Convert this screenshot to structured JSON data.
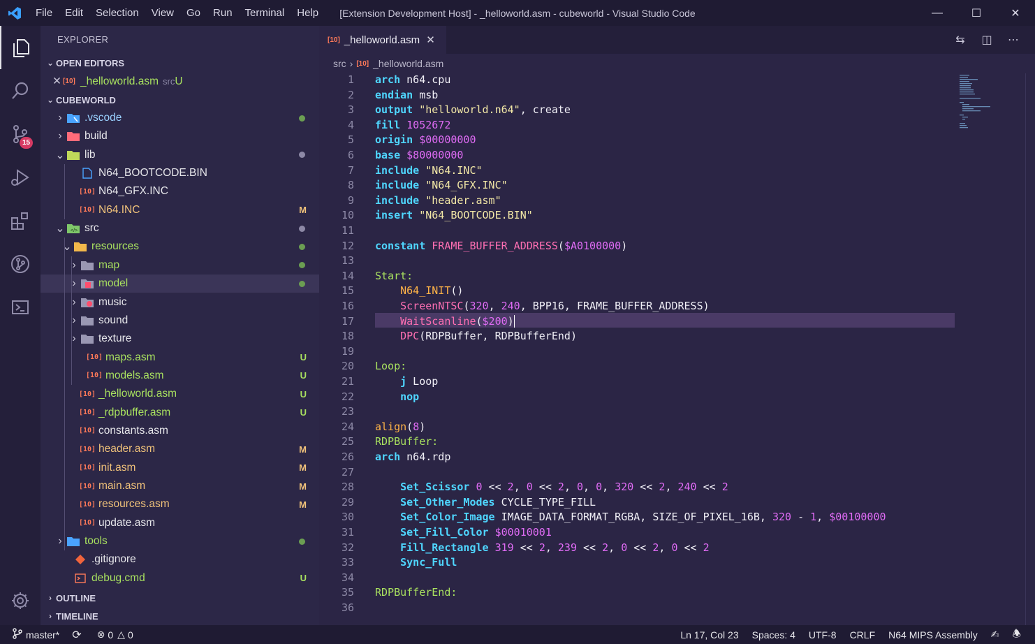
{
  "titlebar": {
    "menu": [
      "File",
      "Edit",
      "Selection",
      "View",
      "Go",
      "Run",
      "Terminal",
      "Help"
    ],
    "title": "[Extension Development Host] - _helloworld.asm - cubeworld - Visual Studio Code"
  },
  "activity": {
    "source_control_badge": "15"
  },
  "sidebar": {
    "title": "EXPLORER",
    "open_editors_label": "OPEN EDITORS",
    "open_editor": {
      "name": "_helloworld.asm",
      "dir": "src",
      "status": "U"
    },
    "workspace_label": "CUBEWORLD",
    "outline_label": "OUTLINE",
    "timeline_label": "TIMELINE",
    "tree": [
      {
        "name": ".vscode",
        "status": "",
        "color": "#9ad1ff"
      },
      {
        "name": "build",
        "status": "",
        "color": "#e6e6ea"
      },
      {
        "name": "lib",
        "status": "",
        "color": "#e6e6ea"
      },
      {
        "name": "N64_BOOTCODE.BIN",
        "status": "",
        "color": "#e6e6ea"
      },
      {
        "name": "N64_GFX.INC",
        "status": "",
        "color": "#e6e6ea"
      },
      {
        "name": "N64.INC",
        "status": "M",
        "color": "#f0c27a"
      },
      {
        "name": "src",
        "status": "",
        "color": "#e6e6ea"
      },
      {
        "name": "resources",
        "status": "",
        "color": "#a8e05f"
      },
      {
        "name": "map",
        "status": "",
        "color": "#a8e05f"
      },
      {
        "name": "model",
        "status": "",
        "color": "#a8e05f"
      },
      {
        "name": "music",
        "status": "",
        "color": "#e6e6ea"
      },
      {
        "name": "sound",
        "status": "",
        "color": "#e6e6ea"
      },
      {
        "name": "texture",
        "status": "",
        "color": "#e6e6ea"
      },
      {
        "name": "maps.asm",
        "status": "U",
        "color": "#a8e05f"
      },
      {
        "name": "models.asm",
        "status": "U",
        "color": "#a8e05f"
      },
      {
        "name": "_helloworld.asm",
        "status": "U",
        "color": "#a8e05f"
      },
      {
        "name": "_rdpbuffer.asm",
        "status": "U",
        "color": "#a8e05f"
      },
      {
        "name": "constants.asm",
        "status": "",
        "color": "#e6e6ea"
      },
      {
        "name": "header.asm",
        "status": "M",
        "color": "#f0c27a"
      },
      {
        "name": "init.asm",
        "status": "M",
        "color": "#f0c27a"
      },
      {
        "name": "main.asm",
        "status": "M",
        "color": "#f0c27a"
      },
      {
        "name": "resources.asm",
        "status": "M",
        "color": "#f0c27a"
      },
      {
        "name": "update.asm",
        "status": "",
        "color": "#e6e6ea"
      },
      {
        "name": "tools",
        "status": "",
        "color": "#a8e05f"
      },
      {
        "name": ".gitignore",
        "status": "",
        "color": "#e6e6ea"
      },
      {
        "name": "debug.cmd",
        "status": "U",
        "color": "#a8e05f"
      }
    ]
  },
  "editor": {
    "tab_label": "_helloworld.asm",
    "breadcrumb": [
      "src",
      "_helloworld.asm"
    ],
    "line_numbers": [
      "1",
      "2",
      "3",
      "4",
      "5",
      "6",
      "7",
      "8",
      "9",
      "10",
      "11",
      "12",
      "13",
      "14",
      "15",
      "16",
      "17",
      "18",
      "19",
      "20",
      "21",
      "22",
      "23",
      "24",
      "25",
      "26",
      "27",
      "28",
      "29",
      "30",
      "31",
      "32",
      "33",
      "34",
      "35",
      "36"
    ]
  },
  "statusbar": {
    "branch": "master*",
    "errors": "0",
    "warnings": "0",
    "position": "Ln 17, Col 23",
    "spaces": "Spaces: 4",
    "encoding": "UTF-8",
    "eol": "CRLF",
    "language": "N64 MIPS Assembly"
  }
}
